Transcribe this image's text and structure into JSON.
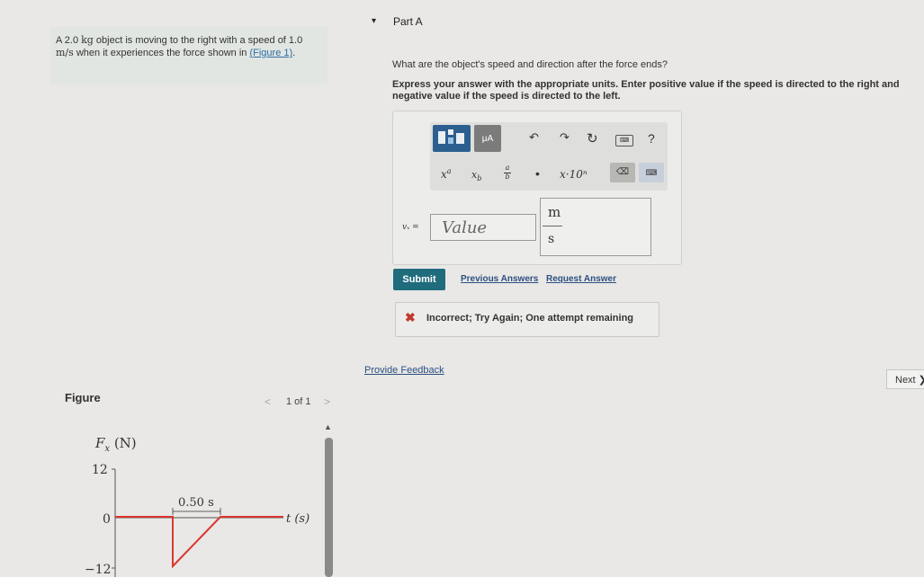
{
  "problem": {
    "text_before": "A 2.0 ",
    "unit_kg": "kg",
    "text_mid": " object is moving to the right with a speed of 1.0 ",
    "unit_speed": "m/s",
    "text_after": " when it experiences the force shown in ",
    "figure_link": "(Figure 1)",
    "text_end": "."
  },
  "figure": {
    "title": "Figure",
    "counter": "1 of 1",
    "prev": "<",
    "next": ">",
    "y_axis_label": "F",
    "y_axis_sub": "x",
    "y_axis_unit": " (N)",
    "x_axis_label": "t (s)",
    "tick_top": "12",
    "tick_mid": "0",
    "tick_bottom": "−12",
    "duration_label": "0.50 s",
    "force_min_N": -12,
    "force_max_N": 12,
    "pulse_duration_s": 0.5
  },
  "partA": {
    "caret": "▾",
    "title": "Part A",
    "question": "What are the object's speed and direction after the force ends?",
    "instructions": "Express your answer with the appropriate units. Enter positive value if the speed is directed to the right and negative value if the speed is directed to the left.",
    "toolbar": {
      "units_label": "μA",
      "undo": "↶",
      "redo": "↷",
      "reset": "↻",
      "keyboard": "⌨",
      "help": "?",
      "sup": "x",
      "sup_exp": "a",
      "sub": "x",
      "sub_idx": "b",
      "frac_num": "a",
      "frac_den": "b",
      "dot": "•",
      "sci": "x·10ⁿ",
      "backspace": "⌫",
      "keypad": "⌨"
    },
    "var_label": "vₓ =",
    "value_placeholder": "Value",
    "unit_numerator": "m",
    "unit_denominator": "s",
    "submit_label": "Submit",
    "previous_answers": "Previous Answers",
    "request_answer": "Request Answer",
    "feedback_icon": "✖",
    "feedback_text": "Incorrect; Try Again; One attempt remaining"
  },
  "provide_feedback": "Provide Feedback",
  "next_label": "Next ❯",
  "colors": {
    "accent": "#1f6c7d",
    "error": "#c0392b",
    "graph_line": "#d9372f",
    "link": "#2c4f80"
  }
}
